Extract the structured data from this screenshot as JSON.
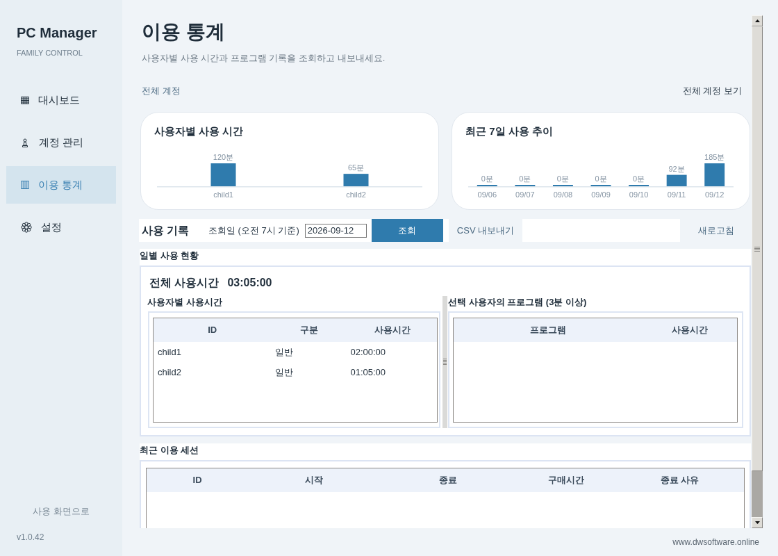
{
  "sidebar": {
    "title": "PC Manager",
    "subtitle": "FAMILY CONTROL",
    "items": [
      {
        "label": "대시보드",
        "selected": false
      },
      {
        "label": "계정 관리",
        "selected": false
      },
      {
        "label": "이용 통계",
        "selected": true
      },
      {
        "label": "설정",
        "selected": false
      }
    ],
    "back_link": "사용 화면으로",
    "version": "v1.0.42"
  },
  "header": {
    "title": "이용 통계",
    "subtitle": "사용자별 사용 시간과 프로그램 기록을 조회하고 내보내세요.",
    "scope_label": "전체 계정",
    "scope_link": "전체 계정 보기"
  },
  "cards": [
    {
      "chart_data": {
        "type": "bar",
        "title": "사용자별 사용 시간",
        "categories": [
          "child1",
          "child2"
        ],
        "values": [
          120,
          65
        ],
        "value_labels": [
          "120분",
          "65분"
        ]
      }
    },
    {
      "chart_data": {
        "type": "bar",
        "title": "최근 7일 사용 추이",
        "categories": [
          "09/06",
          "09/07",
          "09/08",
          "09/09",
          "09/10",
          "09/11",
          "09/12"
        ],
        "values": [
          0,
          0,
          0,
          0,
          0,
          92,
          185
        ],
        "value_labels": [
          "0분",
          "0분",
          "0분",
          "0분",
          "0분",
          "92분",
          "185분"
        ]
      }
    }
  ],
  "usage_log": {
    "title": "사용 기록",
    "date_label": "조회일 (오전 7시 기준)",
    "date_value": "2026-09-12",
    "query_button": "조회",
    "export_button": "CSV 내보내기",
    "refresh_button": "새로고침"
  },
  "daily_status": {
    "title": "일별 사용 현황",
    "total_label": "전체 사용시간",
    "total_value": "03:05:00",
    "users_panel": {
      "title": "사용자별 사용시간",
      "columns": [
        "ID",
        "구분",
        "사용시간"
      ],
      "rows": [
        [
          "child1",
          "일반",
          "02:00:00"
        ],
        [
          "child2",
          "일반",
          "01:05:00"
        ]
      ]
    },
    "programs_panel": {
      "title": "선택 사용자의 프로그램 (3분 이상)",
      "columns": [
        "프로그램",
        "사용시간"
      ]
    }
  },
  "recent_sessions": {
    "title": "최근 이용 세션",
    "columns": [
      "ID",
      "시작",
      "종료",
      "구매시간",
      "종료 사유"
    ]
  },
  "footer": {
    "text": "www.dwsoftware.online"
  }
}
